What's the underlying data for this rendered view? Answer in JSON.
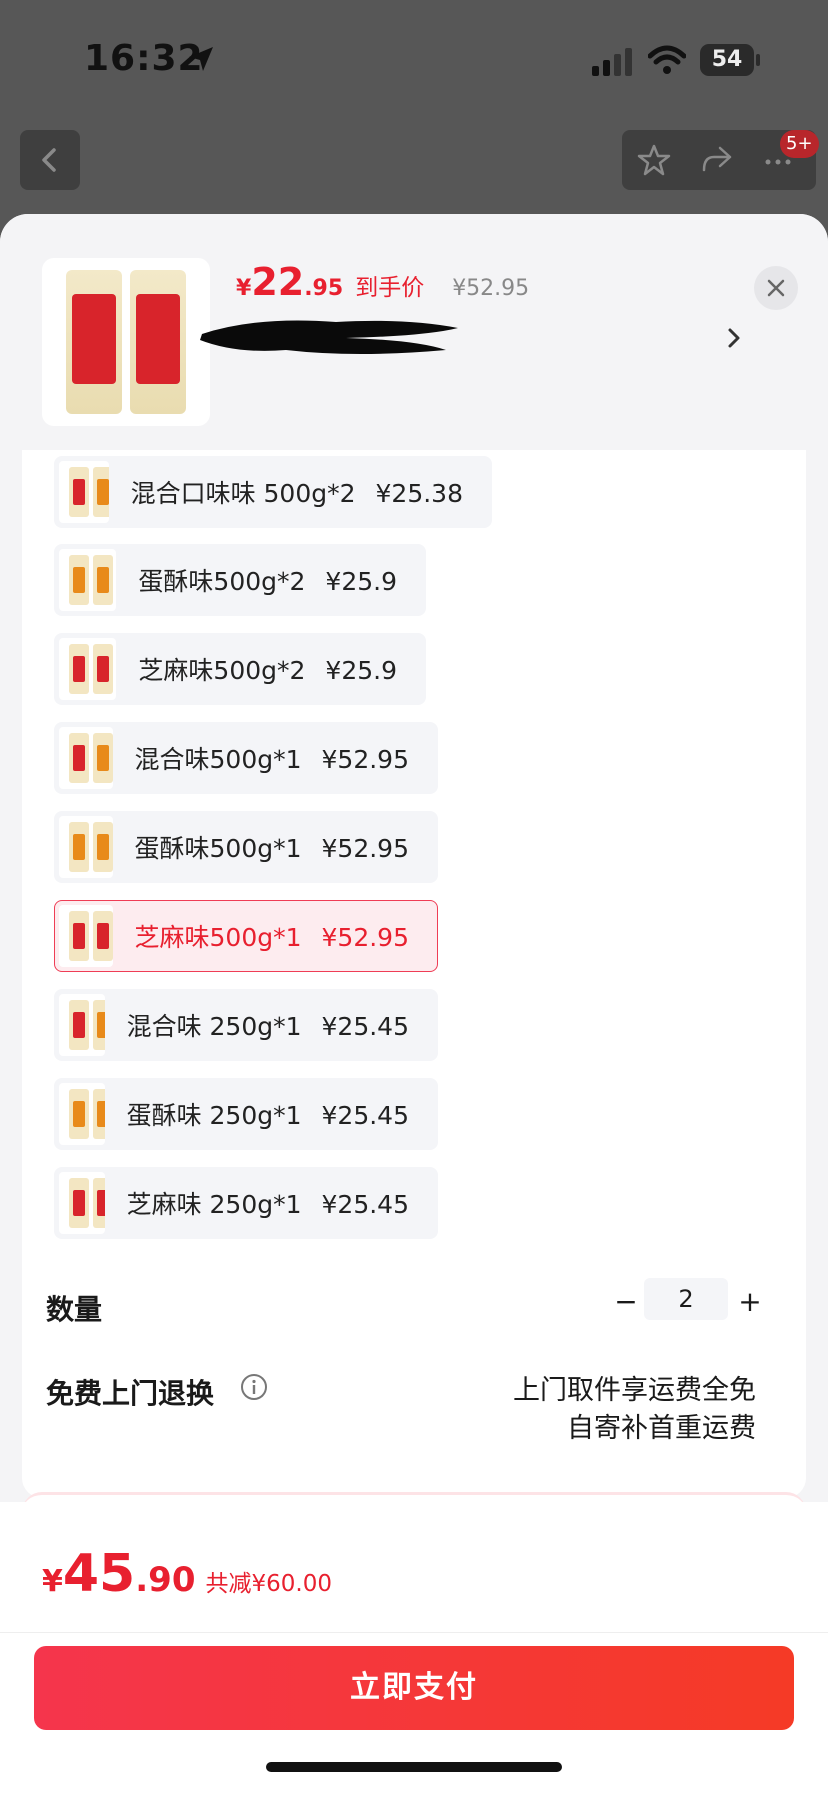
{
  "status_bar": {
    "time": "16:32",
    "battery": "54"
  },
  "top_nav": {
    "notif_badge": "5+"
  },
  "product": {
    "price_yen": "¥",
    "price_int": "22",
    "price_dec": ".95",
    "price_tag": "到手价",
    "original_price": "¥52.95"
  },
  "options": [
    {
      "name": "混合口味味 500g*2",
      "price": "¥25.38",
      "flavor": "mixed",
      "selected": false
    },
    {
      "name": "蛋酥味500g*2",
      "price": "¥25.9",
      "flavor": "egg",
      "selected": false
    },
    {
      "name": "芝麻味500g*2",
      "price": "¥25.9",
      "flavor": "sesame",
      "selected": false
    },
    {
      "name": "混合味500g*1",
      "price": "¥52.95",
      "flavor": "mixed",
      "selected": false
    },
    {
      "name": "蛋酥味500g*1",
      "price": "¥52.95",
      "flavor": "egg",
      "selected": false
    },
    {
      "name": "芝麻味500g*1",
      "price": "¥52.95",
      "flavor": "sesame",
      "selected": true
    },
    {
      "name": "混合味 250g*1",
      "price": "¥25.45",
      "flavor": "mixed",
      "selected": false
    },
    {
      "name": "蛋酥味 250g*1",
      "price": "¥25.45",
      "flavor": "egg",
      "selected": false
    },
    {
      "name": "芝麻味 250g*1",
      "price": "¥25.45",
      "flavor": "sesame",
      "selected": false
    }
  ],
  "quantity": {
    "label": "数量",
    "minus": "−",
    "value": "2",
    "plus": "+"
  },
  "returns": {
    "label": "免费上门退换",
    "line1": "上门取件享运费全免",
    "line2": "自寄补首重运费"
  },
  "summary": {
    "yen": "¥",
    "total_int": "45",
    "total_dec": ".90",
    "discount": "共减¥60.00"
  },
  "pay_button": "立即支付",
  "colors": {
    "accent": "#e8202f",
    "selected_bg": "#fdecef",
    "selected_border": "#ef3d55"
  }
}
